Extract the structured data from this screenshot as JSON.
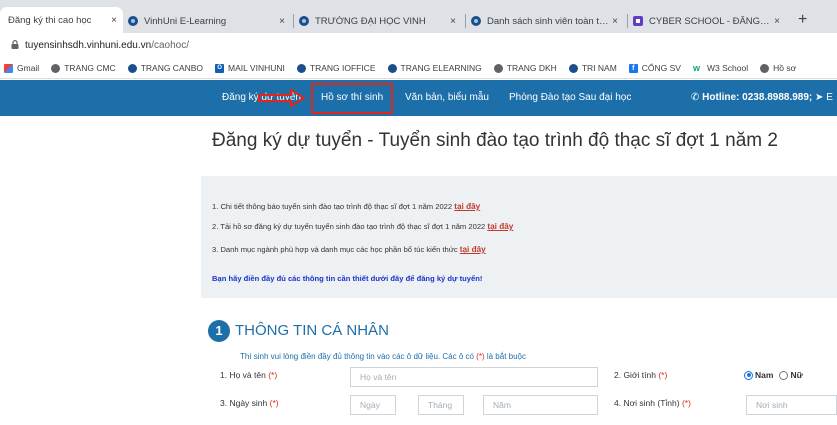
{
  "browser": {
    "tabs": [
      {
        "title": "Đăng ký thi cao học",
        "active": true
      },
      {
        "title": "VinhUni E-Learning",
        "active": false
      },
      {
        "title": "TRƯỜNG ĐẠI HỌC VINH",
        "active": false
      },
      {
        "title": "Danh sách sinh viên toàn trường",
        "active": false
      },
      {
        "title": "CYBER SCHOOL - ĐĂNG KÝ SIZE",
        "active": false
      }
    ],
    "new_tab_label": "+",
    "close_glyph": "×",
    "url_host": "tuyensinhsdh.vinhuni.edu.vn",
    "url_path": "/caohoc/"
  },
  "bookmarks": [
    {
      "label": "Gmail",
      "icon": "gmail-icon"
    },
    {
      "label": "TRANG CMC",
      "icon": "globe-icon"
    },
    {
      "label": "TRANG CANBO",
      "icon": "vinhuni-icon"
    },
    {
      "label": "MAIL VINHUNI",
      "icon": "outlook-icon"
    },
    {
      "label": "TRANG IOFFICE",
      "icon": "vinhuni-icon"
    },
    {
      "label": "TRANG ELEARNING",
      "icon": "vinhuni-icon"
    },
    {
      "label": "TRANG DKH",
      "icon": "globe-icon"
    },
    {
      "label": "TRI NAM",
      "icon": "vinhuni-icon"
    },
    {
      "label": "CỔNG SV",
      "icon": "facebook-icon"
    },
    {
      "label": "W3 School",
      "icon": "w3-icon"
    },
    {
      "label": "Hồ sơ",
      "icon": "globe-icon"
    }
  ],
  "nav": {
    "items": [
      "Đăng ký dự tuyển",
      "Hồ sơ thí sinh",
      "Văn bản, biểu mẫu",
      "Phòng Đào tạo Sau đại học"
    ],
    "hotline_label": "Hotline: 0238.8988.989;",
    "hotline_extra": "E"
  },
  "page": {
    "title": "Đăng ký dự tuyển - Tuyển sinh đào tạo trình độ thạc sĩ đợt 1 năm 2"
  },
  "info": {
    "lines": [
      {
        "text": "1. Chi tiết thông báo tuyển sinh đào tạo trình độ thạc sĩ đợt 1 năm 2022 ",
        "link": "tại đây"
      },
      {
        "text": "2. Tải hồ sơ đăng ký dự tuyển tuyển sinh đào tạo trình độ thạc sĩ đợt 1 năm 2022 ",
        "link": "tại đây"
      },
      {
        "text": "3. Danh mục ngành phù hợp và danh mục các học phần bổ túc kiến thức ",
        "link": "tại đây"
      }
    ],
    "note": "Bạn hãy điền đầy đủ các thông tin cần thiết dưới đây để đăng ký dự tuyển!"
  },
  "section": {
    "number": "1",
    "title": "THÔNG TIN CÁ NHÂN",
    "note": "Thí sinh vui lòng điền đầy đủ thông tin vào các ô dữ liệu. Các ô có ",
    "note_req": "(*)",
    "note_end": " là bắt buộc",
    "required_mark": "(*)",
    "fields": {
      "full_name": {
        "label": "1. Họ và tên ",
        "placeholder": "Họ và tên",
        "value": ""
      },
      "gender": {
        "label": "2. Giới tính ",
        "options": [
          "Nam",
          "Nữ"
        ],
        "selected": "Nam"
      },
      "birth_date": {
        "label": "3. Ngày sinh ",
        "day_placeholder": "Ngày",
        "month_placeholder": "Tháng",
        "year_placeholder": "Năm"
      },
      "birth_place": {
        "label": "4. Nơi sinh (Tỉnh) ",
        "placeholder": "Nơi sinh",
        "value": ""
      }
    }
  },
  "colors": {
    "nav_bg": "#1d6fa9",
    "highlight_red": "#e0261a",
    "link_red": "#c0392b",
    "note_blue": "#1a33c9"
  }
}
